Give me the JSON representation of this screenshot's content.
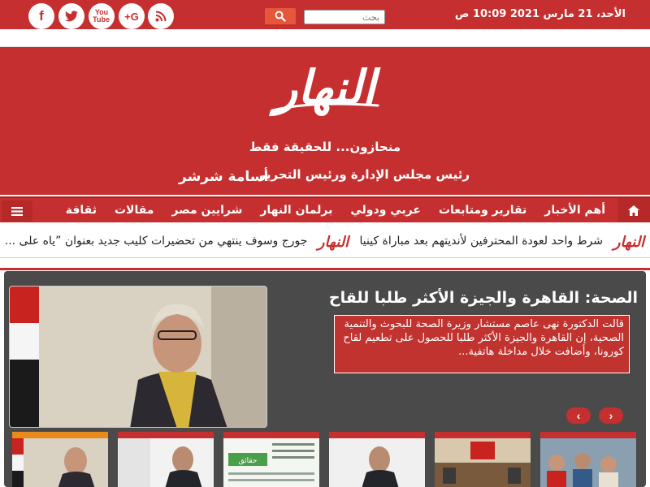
{
  "topbar": {
    "date": "الأحد، 21 مارس 2021 10:09 ص",
    "search_placeholder": "بحث",
    "social": [
      "facebook-icon",
      "twitter-icon",
      "youtube-icon",
      "google-plus-icon",
      "rss-icon"
    ],
    "social_labels": {
      "facebook": "f",
      "youtube": "You Tube",
      "google_plus": "G+"
    }
  },
  "header": {
    "logo_text": "النهار",
    "tagline": "منحازون... للحقيقة فقط",
    "chairman_title": "رئيس مجلس الإدارة ورئيس التحرير",
    "chairman_name": "أسامة شرشر"
  },
  "nav": {
    "items": [
      "أهم الأخبار",
      "تقارير ومتابعات",
      "عربي ودولي",
      "برلمان النهار",
      "شرايين مصر",
      "مقالات",
      "ثقافة"
    ]
  },
  "ticker": {
    "items": [
      "شرط واحد لعودة المحترفين لأنديتهم بعد مباراة كينيا",
      "جورج وسوف ينتهي من تحضيرات كليب جديد بعنوان ”ياه على ..."
    ]
  },
  "featured": {
    "title": "الصحة: القاهرة والجيزة الأكثر طلبا للقاح",
    "summary": "قالت الدكتورة نهى عاصم مستشار وزيرة الصحة للبحوث والتنمية الصحية، إن القاهرة والجيزة الأكثر طلبا للحصول على تطعيم لقاح كورونا، وأضافت خلال مداخلة هاتفية...",
    "prev_label": "‹",
    "next_label": "›",
    "thumb_text": "حقائق"
  },
  "colors": {
    "brand_red": "#c62f2f",
    "dark_panel": "#4a4a4a",
    "active_thumb": "#e98a1c"
  }
}
